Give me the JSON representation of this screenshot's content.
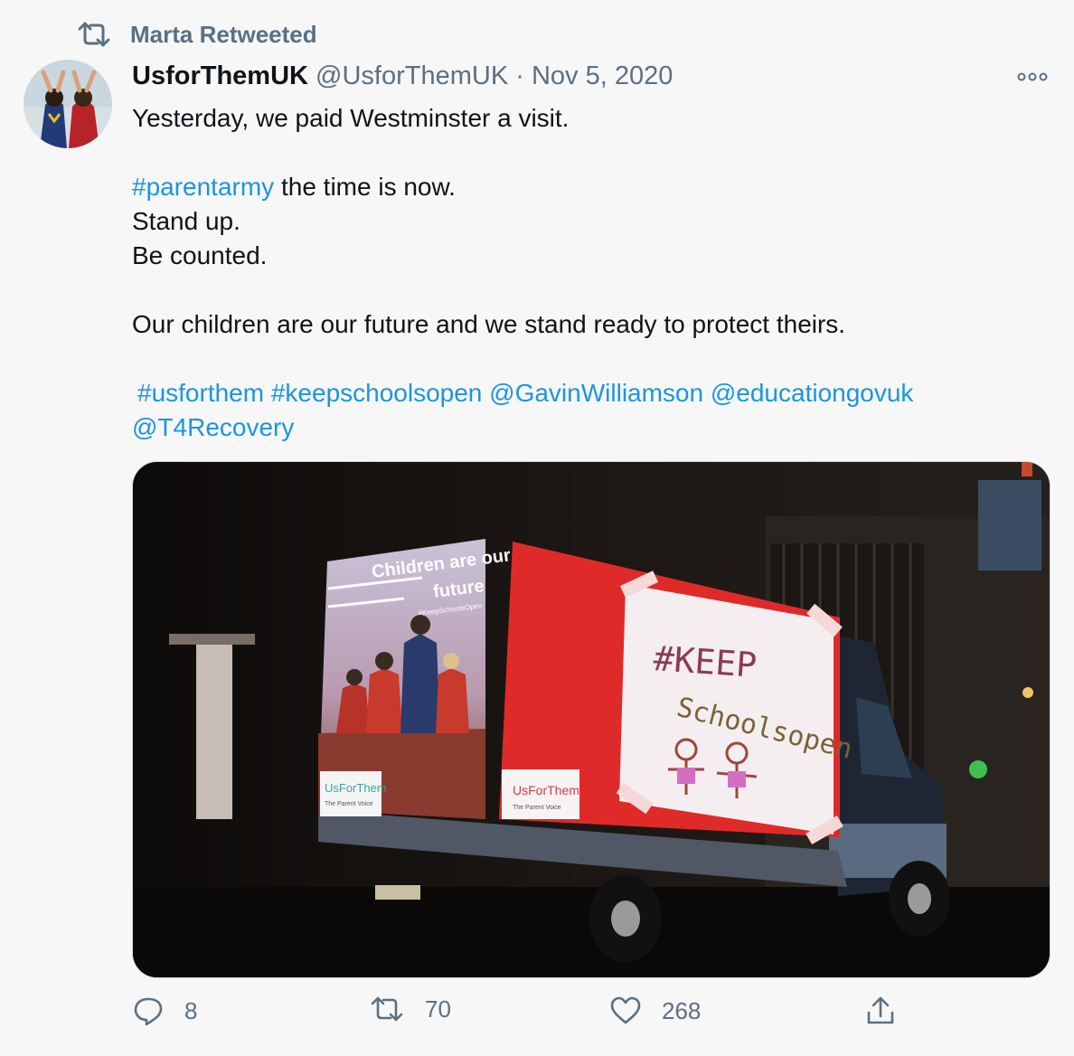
{
  "retweet": {
    "label": "Marta Retweeted",
    "icon": "retweet-icon"
  },
  "author": {
    "display_name": "UsforThemUK",
    "handle": "@UsforThemUK",
    "separator": "·",
    "date": "Nov 5, 2020"
  },
  "tweet_lines": {
    "l1": "Yesterday, we paid Westminster a visit.",
    "l2_tag": "#parentarmy",
    "l2_rest": " the time is now.",
    "l3": "Stand up.",
    "l4": "Be counted.",
    "l5": "Our children are our future and we stand ready to protect theirs.",
    "l6_a": "#usforthem",
    "l6_b": "#keepschoolsopen",
    "l6_c": "@GavinWilliamson",
    "l6_d": "@educationgovuk",
    "l7": "@T4Recovery"
  },
  "media": {
    "screen_left_title_1": "Children are our",
    "screen_left_title_2": "future",
    "screen_left_small": "#KeepSchoolsOpen",
    "logo_left": "UsForThem",
    "logo_left_sub": "The Parent Voice",
    "logo_right": "UsForThem",
    "logo_right_sub": "The Parent Voice",
    "poster_line1": "#KEEP",
    "poster_line2": "Schoolsopen"
  },
  "actions": {
    "reply_count": "8",
    "retweet_count": "70",
    "like_count": "268"
  },
  "colors": {
    "link": "#1b95e0",
    "muted": "#5b7083",
    "background": "#f7f7f7"
  }
}
